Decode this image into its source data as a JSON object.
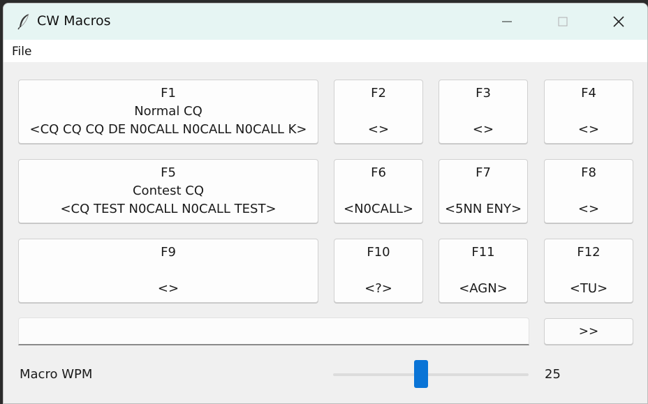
{
  "window": {
    "title": "CW Macros"
  },
  "menu": {
    "items": [
      "File"
    ]
  },
  "macros": [
    {
      "key": "F1",
      "name": "Normal CQ",
      "text": "<CQ CQ CQ DE N0CALL N0CALL N0CALL K>"
    },
    {
      "key": "F2",
      "name": "",
      "text": "<>"
    },
    {
      "key": "F3",
      "name": "",
      "text": "<>"
    },
    {
      "key": "F4",
      "name": "",
      "text": "<>"
    },
    {
      "key": "F5",
      "name": "Contest CQ",
      "text": "<CQ TEST N0CALL N0CALL TEST>"
    },
    {
      "key": "F6",
      "name": "",
      "text": "<N0CALL>"
    },
    {
      "key": "F7",
      "name": "",
      "text": "<5NN ENY>"
    },
    {
      "key": "F8",
      "name": "",
      "text": "<>"
    },
    {
      "key": "F9",
      "name": "",
      "text": "<>"
    },
    {
      "key": "F10",
      "name": "",
      "text": "<?>"
    },
    {
      "key": "F11",
      "name": "",
      "text": "<AGN>"
    },
    {
      "key": "F12",
      "name": "",
      "text": "<TU>"
    }
  ],
  "entry": {
    "value": ""
  },
  "send_button": {
    "label": ">>"
  },
  "wpm": {
    "label": "Macro WPM",
    "value": "25",
    "slider_fraction": 0.45
  },
  "colors": {
    "titlebar": "#e6f5f3",
    "accent": "#0a74d6"
  }
}
